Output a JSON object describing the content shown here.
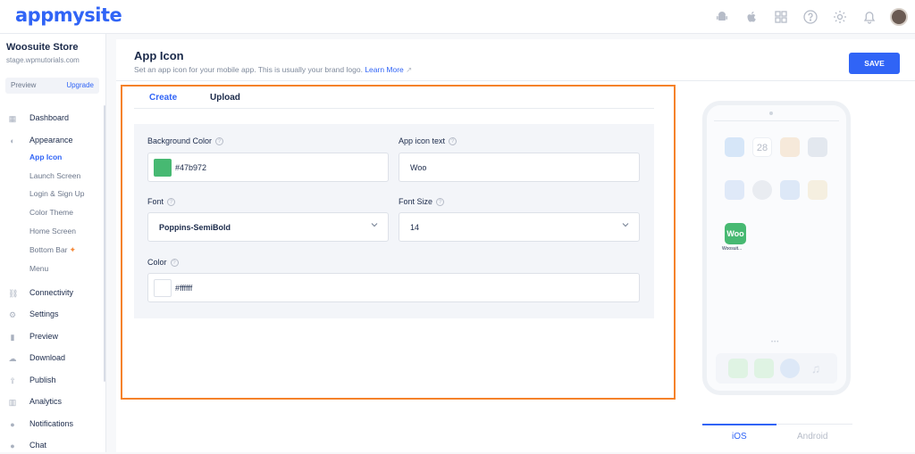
{
  "brand": {
    "logo": "appmysite",
    "accent": "#3064f6",
    "highlight": "#f5822a"
  },
  "topbar": {
    "icons": [
      "android-icon",
      "apple-icon",
      "grid-icon",
      "help-icon",
      "settings-icon",
      "bell-icon",
      "avatar"
    ]
  },
  "sidebar": {
    "store_name": "Woosuite Store",
    "store_url": "stage.wpmutorials.com",
    "preview": "Preview",
    "upgrade": "Upgrade",
    "items": [
      {
        "label": "Dashboard",
        "icon": "dashboard-icon"
      },
      {
        "label": "Appearance",
        "icon": "palette-icon"
      },
      {
        "label": "Connectivity",
        "icon": "link-icon"
      },
      {
        "label": "Settings",
        "icon": "gear-icon"
      },
      {
        "label": "Preview",
        "icon": "phone-icon"
      },
      {
        "label": "Download",
        "icon": "cloud-icon"
      },
      {
        "label": "Publish",
        "icon": "upload-icon"
      },
      {
        "label": "Analytics",
        "icon": "chart-icon"
      },
      {
        "label": "Notifications",
        "icon": "bell-icon"
      },
      {
        "label": "Chat",
        "icon": "chat-icon"
      }
    ],
    "appearance_sub": [
      "App Icon",
      "Launch Screen",
      "Login & Sign Up",
      "Color Theme",
      "Home Screen",
      "Bottom Bar",
      "Menu"
    ]
  },
  "header": {
    "title": "App Icon",
    "subtitle": "Set an app icon for your mobile app. This is usually your brand logo.",
    "learn_more": "Learn More",
    "save": "SAVE"
  },
  "tabs": [
    "Create",
    "Upload"
  ],
  "form": {
    "background_color": {
      "label": "Background Color",
      "value": "#47b972"
    },
    "app_icon_text": {
      "label": "App icon text",
      "value": "Woo"
    },
    "font": {
      "label": "Font",
      "value": "Poppins-SemiBold"
    },
    "font_size": {
      "label": "Font Size",
      "value": "14"
    },
    "color": {
      "label": "Color",
      "value": "#ffffff"
    }
  },
  "preview": {
    "date_num": "28",
    "app_icon_text": "Woo",
    "app_name": "Woosuit...",
    "os_tabs": [
      "iOS",
      "Android"
    ],
    "active_os": "iOS"
  }
}
